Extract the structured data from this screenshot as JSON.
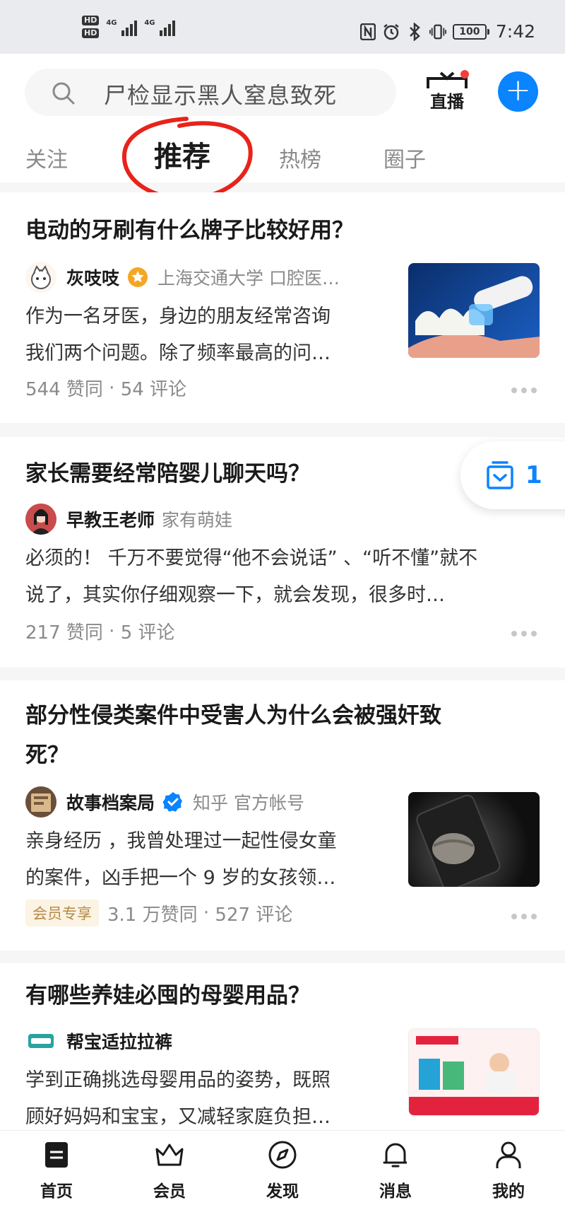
{
  "status_bar": {
    "hd1": "HD",
    "hd2": "HD",
    "net1": "4G",
    "net2": "4G",
    "battery": "100",
    "time": "7:42"
  },
  "search": {
    "placeholder": "尸检显示黑人窒息致死"
  },
  "header": {
    "live_label": "直播"
  },
  "tabs": [
    {
      "label": "关注",
      "active": false
    },
    {
      "label": "推荐",
      "active": true
    },
    {
      "label": "热榜",
      "active": false
    },
    {
      "label": "圈子",
      "active": false
    }
  ],
  "feed": [
    {
      "title": "电动的牙刷有什么牌子比较好用？",
      "author": "灰吱吱",
      "author_desc": "上海交通大学 口腔医…",
      "excerpt": [
        "作为一名牙医，身边的朋友经常咨询",
        "我们两个问题。除了频率最高的问…"
      ],
      "likes": "544 赞同",
      "comments": "54 评论"
    },
    {
      "title": "家长需要经常陪婴儿聊天吗？",
      "author": "早教王老师",
      "author_desc": "家有萌娃",
      "excerpt": [
        "必须的！ 千万不要觉得“他不会说话” 、“听不懂”就不",
        "说了，其实你仔细观察一下，就会发现，很多时…"
      ],
      "likes": "217 赞同",
      "comments": "5 评论"
    },
    {
      "title": [
        "部分性侵类案件中受害人为什么会被强奸致",
        "死？"
      ],
      "author": "故事档案局",
      "author_desc": "知乎 官方帐号",
      "excerpt": [
        "亲身经历 ，我曾处理过一起性侵女童",
        "的案件，凶手把一个 9 岁的女孩领…"
      ],
      "badge": "会员专享",
      "likes": "3.1 万赞同",
      "comments": "527 评论"
    },
    {
      "title": "有哪些养娃必囤的母婴用品？",
      "author": "帮宝适拉拉裤",
      "excerpt": [
        "学到正确挑选母婴用品的姿势，既照",
        "顾好妈妈和宝宝，又减轻家庭负担…"
      ]
    }
  ],
  "float_inbox": {
    "count": "1"
  },
  "bottom_nav": [
    {
      "label": "首页",
      "icon": "home-icon"
    },
    {
      "label": "会员",
      "icon": "crown-icon"
    },
    {
      "label": "发现",
      "icon": "compass-icon"
    },
    {
      "label": "消息",
      "icon": "bell-icon"
    },
    {
      "label": "我的",
      "icon": "person-icon"
    }
  ],
  "colors": {
    "accent": "#0a84ff",
    "annotation": "#e8231b",
    "vip_text": "#b58a44"
  }
}
